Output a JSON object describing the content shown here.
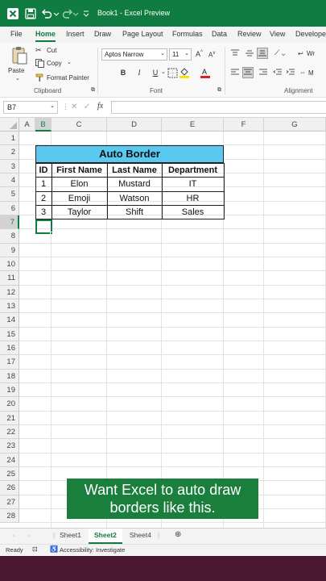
{
  "titlebar": {
    "title": "Book1 - Excel Preview"
  },
  "tabs": [
    "File",
    "Home",
    "Insert",
    "Draw",
    "Page Layout",
    "Formulas",
    "Data",
    "Review",
    "View",
    "Developer"
  ],
  "ribbon": {
    "paste": "Paste",
    "cut": "Cut",
    "copy": "Copy",
    "format_painter": "Format Painter",
    "font_name": "Aptos Narrow",
    "font_size": "11",
    "bold": "B",
    "italic": "I",
    "underline": "U",
    "wrap": "Wr",
    "merge": "M",
    "groups": {
      "clipboard": "Clipboard",
      "font": "Font",
      "alignment": "Alignment"
    }
  },
  "formula_bar": {
    "name_box": "B7",
    "fx": "fx",
    "value": ""
  },
  "columns": [
    "A",
    "B",
    "C",
    "D",
    "E",
    "F",
    "G"
  ],
  "rows": [
    "1",
    "2",
    "3",
    "4",
    "5",
    "6",
    "7",
    "8",
    "9",
    "10",
    "11",
    "12",
    "13",
    "14",
    "15",
    "16",
    "17",
    "18",
    "19",
    "20",
    "21",
    "22",
    "23",
    "24",
    "25",
    "26",
    "27",
    "28"
  ],
  "table": {
    "title": "Auto Border",
    "headers": [
      "ID",
      "First Name",
      "Last Name",
      "Department"
    ],
    "rows": [
      [
        "1",
        "Elon",
        "Mustard",
        "IT"
      ],
      [
        "2",
        "Emoji",
        "Watson",
        "HR"
      ],
      [
        "3",
        "Taylor",
        "Shift",
        "Sales"
      ]
    ]
  },
  "callout": {
    "line1": "Want Excel to auto draw",
    "line2": "borders like this."
  },
  "sheets": [
    "Sheet1",
    "Sheet2",
    "Sheet4"
  ],
  "active_sheet": "Sheet2",
  "status": {
    "ready": "Ready",
    "accessibility": "Accessibility: Investigate"
  },
  "colors": {
    "excel_green": "#107c41",
    "header_fill": "#5bc8f0",
    "callout_bg": "#1a7f3c"
  }
}
